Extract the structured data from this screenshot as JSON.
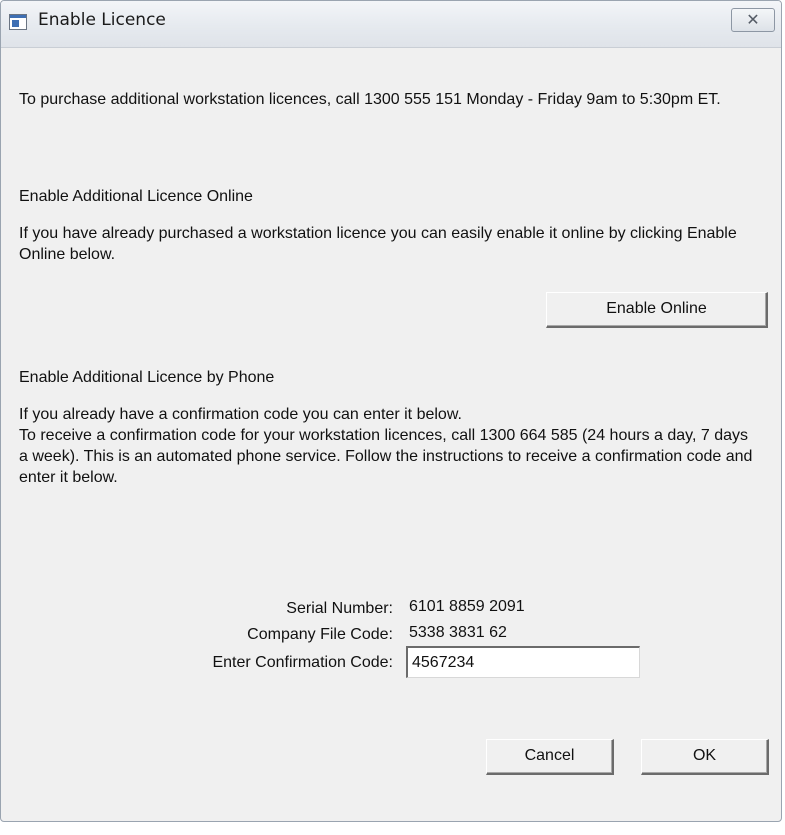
{
  "window": {
    "title": "Enable Licence",
    "close_icon": "close-x-icon",
    "title_icon": "window-app-icon"
  },
  "intro": {
    "purchase_text": "To purchase additional workstation licences, call 1300 555 151 Monday - Friday 9am to 5:30pm ET."
  },
  "online_section": {
    "heading": "Enable Additional Licence Online",
    "description": "If you have already purchased a workstation licence you can easily enable it online by clicking Enable Online below.",
    "enable_online_label": "Enable Online"
  },
  "phone_section": {
    "heading": "Enable Additional Licence by Phone",
    "description_line1": "If you already have a confirmation code you can enter it below.",
    "description_line2": "To receive a confirmation code for your workstation licences, call 1300 664 585 (24 hours a day, 7 days a week).  This is an automated phone service.  Follow the instructions to receive a confirmation code and enter it below."
  },
  "fields": {
    "serial_label": "Serial Number:",
    "serial_value": "6101 8859 2091",
    "company_label": "Company File Code:",
    "company_value": "5338 3831 62",
    "confirmation_label": "Enter Confirmation Code:",
    "confirmation_value": "4567234",
    "confirmation_placeholder": ""
  },
  "buttons": {
    "cancel_label": "Cancel",
    "ok_label": "OK"
  }
}
